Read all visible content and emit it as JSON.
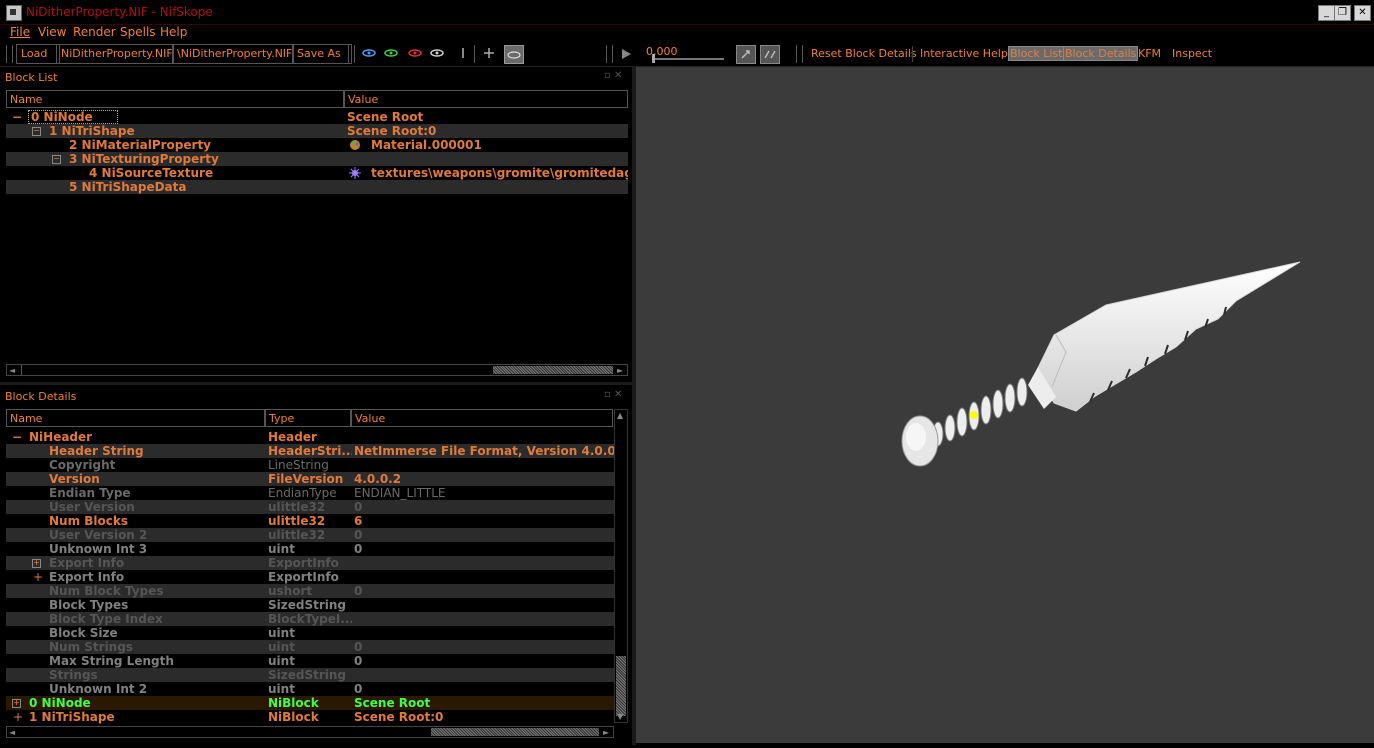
{
  "window": {
    "title": "NiDitherProperty.NIF - NifSkope",
    "minimize": "_",
    "restore": "❐",
    "close": "✕"
  },
  "menu": [
    "File",
    "View",
    "Render",
    "Spells",
    "Help"
  ],
  "toolbar": {
    "load": "Load",
    "load_path": "NiDitherProperty.NIF",
    "save_path": "\\NiDitherProperty.NIF",
    "save_as": "Save As",
    "time_value": "0,000",
    "reset_block_details": "Reset Block Details",
    "interactive_help": "Interactive Help",
    "block_list": "Block List",
    "block_details": "Block Details",
    "kfm": "KFM",
    "inspect": "Inspect"
  },
  "block_list": {
    "title": "Block List",
    "columns": [
      "Name",
      "Value"
    ],
    "rows": [
      {
        "name": "0 NiNode",
        "value": "Scene Root",
        "expander": "−"
      },
      {
        "name": "1 NiTriShape",
        "value": "Scene Root:0",
        "expander": "−"
      },
      {
        "name": "2 NiMaterialProperty",
        "value": "Material.000001",
        "icon": "palette-icon"
      },
      {
        "name": "3 NiTexturingProperty",
        "value": "",
        "expander": "−"
      },
      {
        "name": "4 NiSourceTexture",
        "value": "textures\\weapons\\gromite\\gromitedagge",
        "icon": "texture-icon"
      },
      {
        "name": "5 NiTriShapeData",
        "value": ""
      }
    ]
  },
  "block_details": {
    "title": "Block Details",
    "columns": [
      "Name",
      "Type",
      "Value"
    ],
    "rows": [
      {
        "name": "NiHeader",
        "type": "Header",
        "value": "",
        "expander": "−"
      },
      {
        "name": "Header String",
        "type": "HeaderStri...",
        "value": "NetImmerse File Format, Version 4.0.0.2"
      },
      {
        "name": "Copyright",
        "type": "LineString",
        "value": ""
      },
      {
        "name": "Version",
        "type": "FileVersion",
        "value": "4.0.0.2"
      },
      {
        "name": "Endian Type",
        "type": "EndianType",
        "value": "ENDIAN_LITTLE"
      },
      {
        "name": "User Version",
        "type": "ulittle32",
        "value": "0"
      },
      {
        "name": "Num Blocks",
        "type": "ulittle32",
        "value": "6"
      },
      {
        "name": "User Version 2",
        "type": "ulittle32",
        "value": "0"
      },
      {
        "name": "Unknown Int 3",
        "type": "uint",
        "value": "0"
      },
      {
        "name": "Export Info",
        "type": "ExportInfo",
        "value": "",
        "expander": "+"
      },
      {
        "name": "Export Info",
        "type": "ExportInfo",
        "value": "",
        "expander": "+"
      },
      {
        "name": "Num Block Types",
        "type": "ushort",
        "value": "0"
      },
      {
        "name": "Block Types",
        "type": "SizedString",
        "value": ""
      },
      {
        "name": "Block Type Index",
        "type": "BlockTypeI...",
        "value": ""
      },
      {
        "name": "Block Size",
        "type": "uint",
        "value": ""
      },
      {
        "name": "Num Strings",
        "type": "uint",
        "value": "0"
      },
      {
        "name": "Max String Length",
        "type": "uint",
        "value": "0"
      },
      {
        "name": "Strings",
        "type": "SizedString",
        "value": ""
      },
      {
        "name": "Unknown Int 2",
        "type": "uint",
        "value": "0"
      },
      {
        "name": "0 NiNode",
        "type": "NiBlock",
        "value": "Scene Root",
        "expander": "+"
      },
      {
        "name": "1 NiTriShape",
        "type": "NiBlock",
        "value": "Scene Root:0",
        "expander": "+"
      }
    ]
  },
  "colors": {
    "accent": "#f08030",
    "highlight_green": "#40ff40",
    "viewport_bg": "#3b3b3b"
  }
}
